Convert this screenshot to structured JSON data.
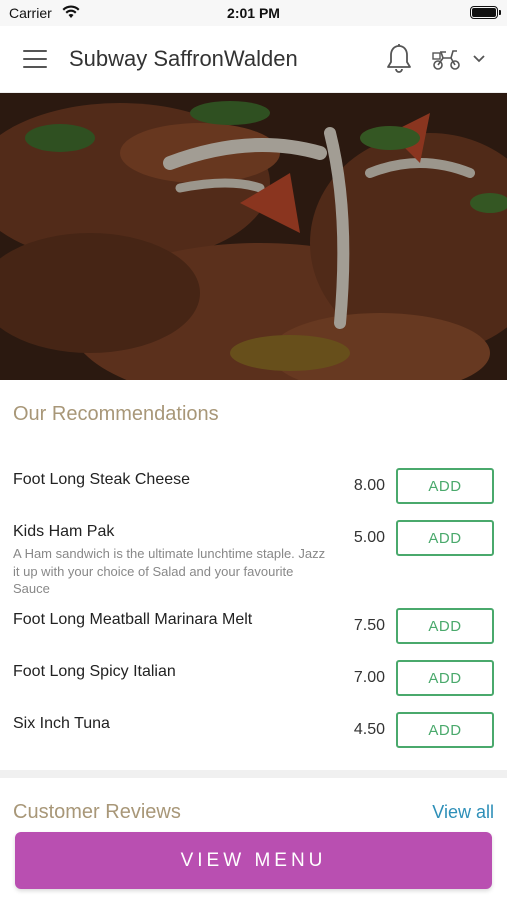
{
  "status_bar": {
    "carrier": "Carrier",
    "time": "2:01 PM"
  },
  "header": {
    "title": "Subway SaffronWalden",
    "icons": [
      "menu-icon",
      "bell-icon",
      "scooter-icon",
      "chevron-down-icon"
    ]
  },
  "recommendations": {
    "title": "Our Recommendations",
    "items": [
      {
        "name": "Foot Long Steak Cheese",
        "description": "",
        "price": "8.00",
        "button": "ADD"
      },
      {
        "name": "Kids Ham Pak",
        "description": "A Ham sandwich is the ultimate lunchtime staple. Jazz it up with your choice of Salad and your favourite Sauce",
        "price": "5.00",
        "button": "ADD"
      },
      {
        "name": "Foot Long Meatball Marinara Melt",
        "description": "",
        "price": "7.50",
        "button": "ADD"
      },
      {
        "name": "Foot Long Spicy Italian",
        "description": "",
        "price": "7.00",
        "button": "ADD"
      },
      {
        "name": "Six Inch Tuna",
        "description": "",
        "price": "4.50",
        "button": "ADD"
      }
    ]
  },
  "reviews": {
    "title": "Customer Reviews",
    "view_all": "View all"
  },
  "footer": {
    "view_menu": "VIEW MENU"
  },
  "colors": {
    "accent_title": "#a89778",
    "add_button": "#4aa96c",
    "link": "#2d8fb8",
    "cta": "#b94fb1"
  }
}
